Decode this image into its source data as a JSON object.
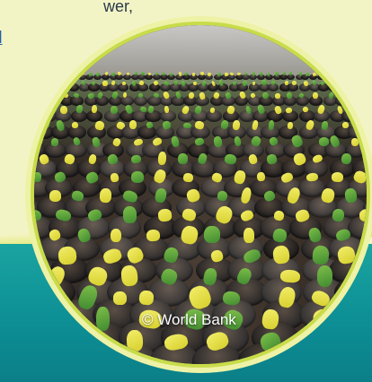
{
  "article": {
    "text_fragment": "wer,",
    "link_fragment": "d"
  },
  "image": {
    "caption": "© World Bank",
    "subject": "seedling nursery"
  },
  "colors": {
    "background": "#f3f4c6",
    "teal": "#0d8f95",
    "ring": "#c8dc4a",
    "link": "#1f5ea8"
  }
}
